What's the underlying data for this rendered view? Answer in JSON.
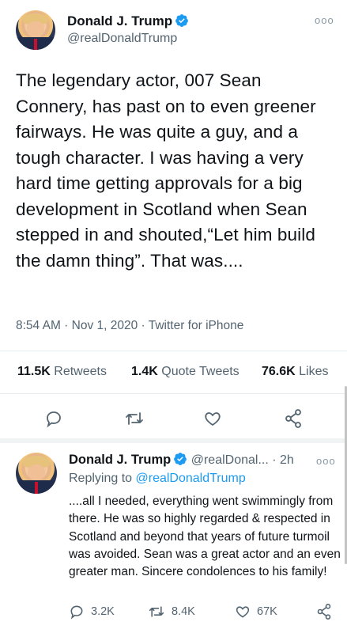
{
  "main_tweet": {
    "author_name": "Donald J. Trump",
    "author_handle": "@realDonaldTrump",
    "text": "The legendary actor, 007 Sean Connery, has past on to even greener fairways. He was quite a guy, and a tough character. I was having a very hard time getting approvals for a big development in Scotland when Sean stepped in and shouted,“Let him build the damn thing”. That was....",
    "meta": "8:54 AM · Nov 1, 2020 · Twitter for iPhone",
    "stats": {
      "retweets_count": "11.5K",
      "retweets_label": "Retweets",
      "quotes_count": "1.4K",
      "quotes_label": "Quote Tweets",
      "likes_count": "76.6K",
      "likes_label": "Likes"
    },
    "actions": [
      "reply-icon",
      "retweet-icon",
      "like-icon",
      "share-icon"
    ]
  },
  "reply_tweet": {
    "author_name": "Donald J. Trump",
    "author_handle": "@realDonal...",
    "time": "· 2h",
    "replying_prefix": "Replying to",
    "replying_to": "@realDonaldTrump",
    "text": "....all I needed, everything went swimmingly from there. He was so highly regarded & respected in Scotland and beyond that years of future turmoil was avoided. Sean was a great actor and an even greater man. Sincere condolences to his family!",
    "reply_count": "3.2K",
    "retweet_count": "8.4K",
    "like_count": "67K"
  },
  "colors": {
    "accent": "#1d9bf0",
    "text": "#0f1419",
    "secondary": "#536471"
  }
}
